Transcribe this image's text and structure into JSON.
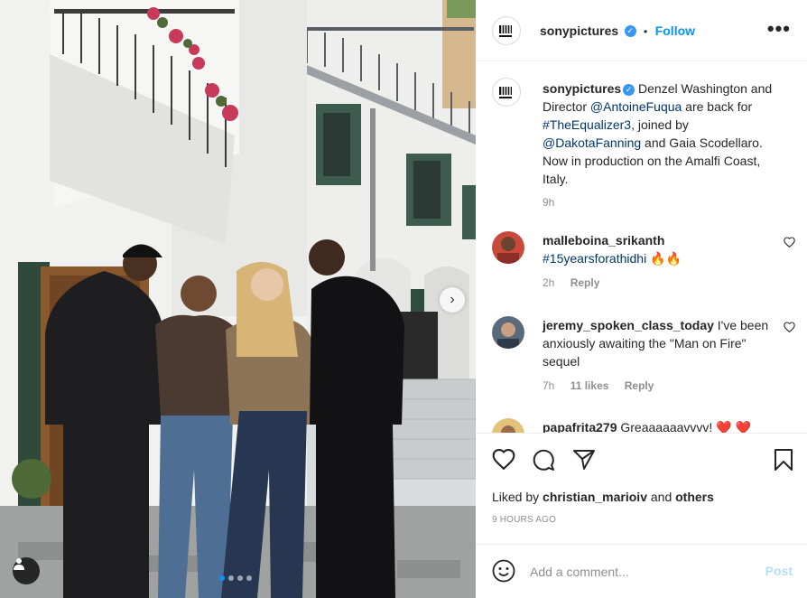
{
  "post": {
    "author": "sonypictures",
    "follow_label": "Follow",
    "separator": "•",
    "more_label": "•••",
    "verified_mark": "✓",
    "caption": {
      "username": "sonypictures",
      "part1": " Denzel Washington and Director ",
      "mention1": "@AntoineFuqua",
      "part2": " are back for ",
      "hashtag": "#TheEqualizer3",
      "part3": ", joined by ",
      "mention2": "@DakotaFanning",
      "part4": " and Gaia Scodellaro. Now in production on the Amalfi Coast, Italy.",
      "time": "9h"
    },
    "comments": [
      {
        "username": "malleboina_srikanth",
        "text": "#15yearsforathidhi 🔥🔥",
        "time": "2h",
        "likes": "",
        "reply_label": "Reply"
      },
      {
        "username": "jeremy_spoken_class_today",
        "text": " I've been anxiously awaiting the \"Man on Fire\" sequel",
        "time": "7h",
        "likes": "11 likes",
        "reply_label": "Reply"
      },
      {
        "username": "papafrita279",
        "text": " Greaaaaaavvvv! ❤️ ❤️",
        "time": "",
        "likes": "",
        "reply_label": ""
      }
    ],
    "liked_by": {
      "prefix": "Liked by ",
      "user": "christian_marioiv",
      "middle": " and ",
      "others": "others"
    },
    "timestamp": "9 HOURS AGO",
    "add_comment": {
      "placeholder": "Add a comment...",
      "post_label": "Post"
    },
    "carousel": {
      "next_label": "›",
      "dots": 4,
      "active_dot": 1
    }
  },
  "icons": [
    "verified-icon",
    "more-icon",
    "heart-icon",
    "comment-icon",
    "share-icon",
    "bookmark-icon",
    "emoji-icon",
    "user-tag-icon",
    "chevron-right-icon"
  ],
  "colors": {
    "link": "#00376b",
    "accent": "#0095f6",
    "post_disabled": "#b2dffc",
    "muted": "#8e8e8e"
  }
}
